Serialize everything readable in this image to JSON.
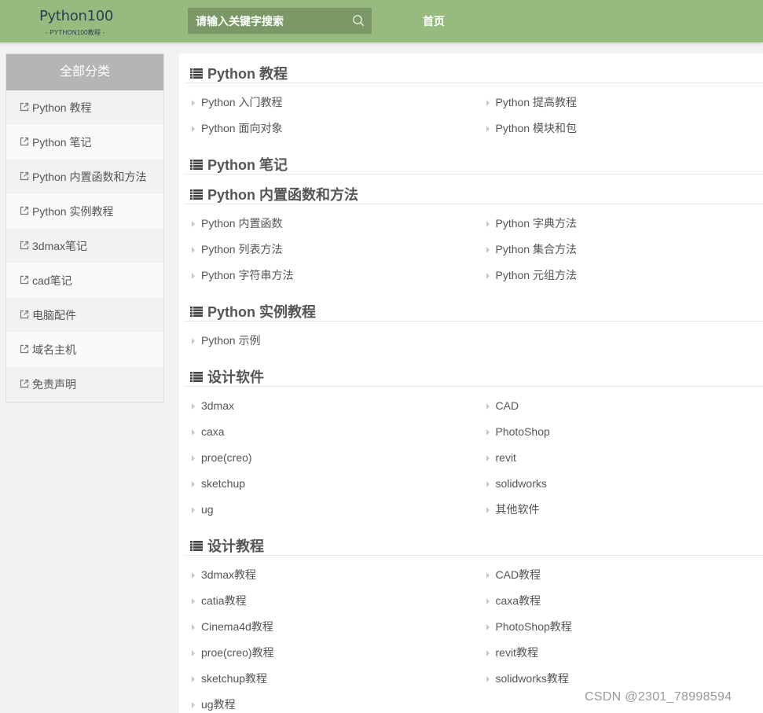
{
  "header": {
    "logo_main": "Python100",
    "logo_sub": "- PYTHON100教程 -",
    "search_placeholder": "请输入关键字搜索",
    "nav_home": "首页"
  },
  "sidebar": {
    "title": "全部分类",
    "items": [
      {
        "label": "Python 教程"
      },
      {
        "label": "Python 笔记"
      },
      {
        "label": "Python 内置函数和方法"
      },
      {
        "label": "Python 实例教程"
      },
      {
        "label": "3dmax笔记"
      },
      {
        "label": "cad笔记"
      },
      {
        "label": "电脑配件"
      },
      {
        "label": "域名主机"
      },
      {
        "label": "免责声明"
      }
    ]
  },
  "sections": [
    {
      "title": "Python 教程",
      "links": [
        "Python 入门教程",
        "Python 提高教程",
        "Python 面向对象",
        "Python 模块和包"
      ]
    },
    {
      "title": "Python 笔记",
      "links": []
    },
    {
      "title": "Python 内置函数和方法",
      "links": [
        "Python 内置函数",
        "Python 字典方法",
        "Python 列表方法",
        "Python 集合方法",
        "Python 字符串方法",
        "Python 元组方法"
      ]
    },
    {
      "title": "Python 实例教程",
      "links": [
        "Python 示例"
      ]
    },
    {
      "title": "设计软件",
      "links": [
        "3dmax",
        "CAD",
        "caxa",
        "PhotoShop",
        "proe(creo)",
        "revit",
        "sketchup",
        "solidworks",
        "ug",
        "其他软件"
      ]
    },
    {
      "title": "设计教程",
      "links": [
        "3dmax教程",
        "CAD教程",
        "catia教程",
        "caxa教程",
        "Cinema4d教程",
        "PhotoShop教程",
        "proe(creo)教程",
        "revit教程",
        "sketchup教程",
        "solidworks教程",
        "ug教程"
      ]
    }
  ],
  "watermark": "CSDN @2301_78998594",
  "colors": {
    "header_bg": "#97bb7f",
    "search_bg": "#7a9966",
    "sidebar_title_bg": "#b5b5b5"
  },
  "icons": {
    "search": "search-icon",
    "sidebar_item": "external-link-icon",
    "section_title": "list-icon",
    "link_bullet": "triangle-right-icon"
  }
}
